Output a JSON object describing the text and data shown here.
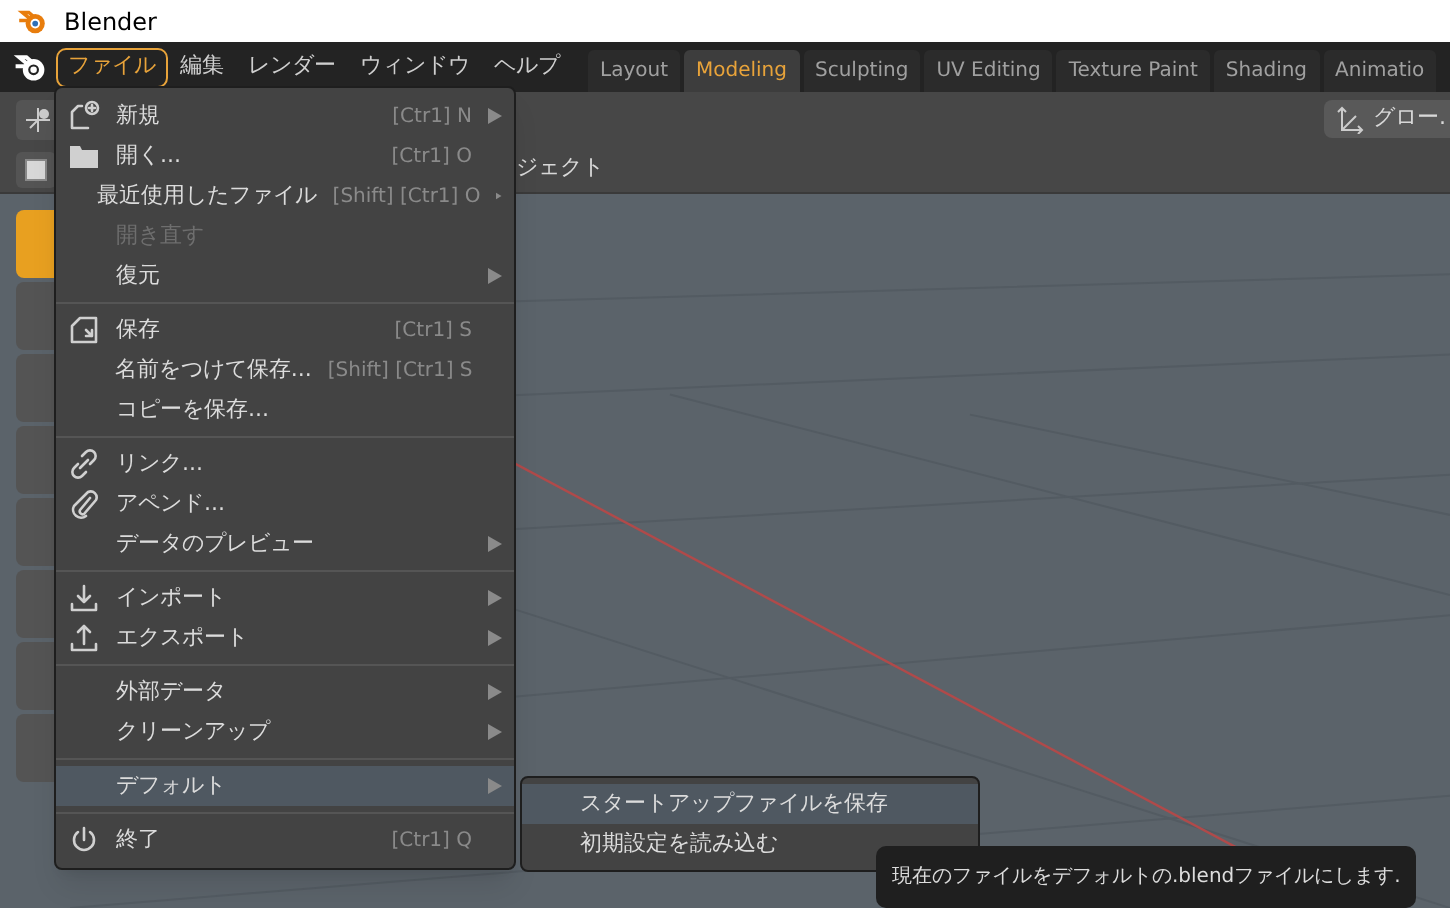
{
  "window": {
    "title": "Blender"
  },
  "menubar": [
    {
      "label": "ファイル",
      "selected": true
    },
    {
      "label": "編集",
      "selected": false
    },
    {
      "label": "レンダー",
      "selected": false
    },
    {
      "label": "ウィンドウ",
      "selected": false
    },
    {
      "label": "ヘルプ",
      "selected": false
    }
  ],
  "workspace_tabs": [
    {
      "label": "Layout",
      "selected": false
    },
    {
      "label": "Modeling",
      "selected": true
    },
    {
      "label": "Sculpting",
      "selected": false
    },
    {
      "label": "UV Editing",
      "selected": false
    },
    {
      "label": "Texture Paint",
      "selected": false
    },
    {
      "label": "Shading",
      "selected": false
    },
    {
      "label": "Animatio",
      "selected": false
    }
  ],
  "header": {
    "object_menu": "ジェクト",
    "orientation": "グロー."
  },
  "toolbar": [
    {
      "active": true
    },
    {
      "active": false
    },
    {
      "active": false
    },
    {
      "active": false
    },
    {
      "active": false
    },
    {
      "active": false
    },
    {
      "active": false
    },
    {
      "active": false
    }
  ],
  "file_menu": [
    [
      {
        "label": "新規",
        "shortcut": "[Ctr1] N",
        "submenu": true,
        "disabled": false,
        "highlighted": false
      },
      {
        "label": "開く...",
        "shortcut": "[Ctr1] O",
        "submenu": false,
        "disabled": false,
        "highlighted": false
      },
      {
        "label": "最近使用したファイル",
        "shortcut": "[Shift] [Ctr1] O",
        "submenu": true,
        "disabled": false,
        "highlighted": false
      },
      {
        "label": "開き直す",
        "submenu": false,
        "disabled": true,
        "highlighted": false
      },
      {
        "label": "復元",
        "submenu": true,
        "disabled": false,
        "highlighted": false
      }
    ],
    [
      {
        "label": "保存",
        "shortcut": "[Ctr1] S",
        "submenu": false,
        "disabled": false,
        "highlighted": false
      },
      {
        "label": "名前をつけて保存...",
        "shortcut": "[Shift] [Ctr1] S",
        "submenu": false,
        "disabled": false,
        "highlighted": false
      },
      {
        "label": "コピーを保存...",
        "submenu": false,
        "disabled": false,
        "highlighted": false
      }
    ],
    [
      {
        "label": "リンク...",
        "submenu": false,
        "disabled": false,
        "highlighted": false
      },
      {
        "label": "アペンド...",
        "submenu": false,
        "disabled": false,
        "highlighted": false
      },
      {
        "label": "データのプレビュー",
        "submenu": true,
        "disabled": false,
        "highlighted": false
      }
    ],
    [
      {
        "label": "インポート",
        "submenu": true,
        "disabled": false,
        "highlighted": false
      },
      {
        "label": "エクスポート",
        "submenu": true,
        "disabled": false,
        "highlighted": false
      }
    ],
    [
      {
        "label": "外部データ",
        "submenu": true,
        "disabled": false,
        "highlighted": false
      },
      {
        "label": "クリーンアップ",
        "submenu": true,
        "disabled": false,
        "highlighted": false
      }
    ],
    [
      {
        "label": "デフォルト",
        "submenu": true,
        "disabled": false,
        "highlighted": true
      }
    ],
    [
      {
        "label": "終了",
        "shortcut": "[Ctr1] Q",
        "submenu": false,
        "disabled": false,
        "highlighted": false
      }
    ]
  ],
  "default_submenu": [
    {
      "label": "スタートアップファイルを保存",
      "highlighted": true
    },
    {
      "label": "初期設定を読み込む",
      "highlighted": false
    }
  ],
  "tooltip": "現在のファイルをデフォルトの.blendファイルにします."
}
